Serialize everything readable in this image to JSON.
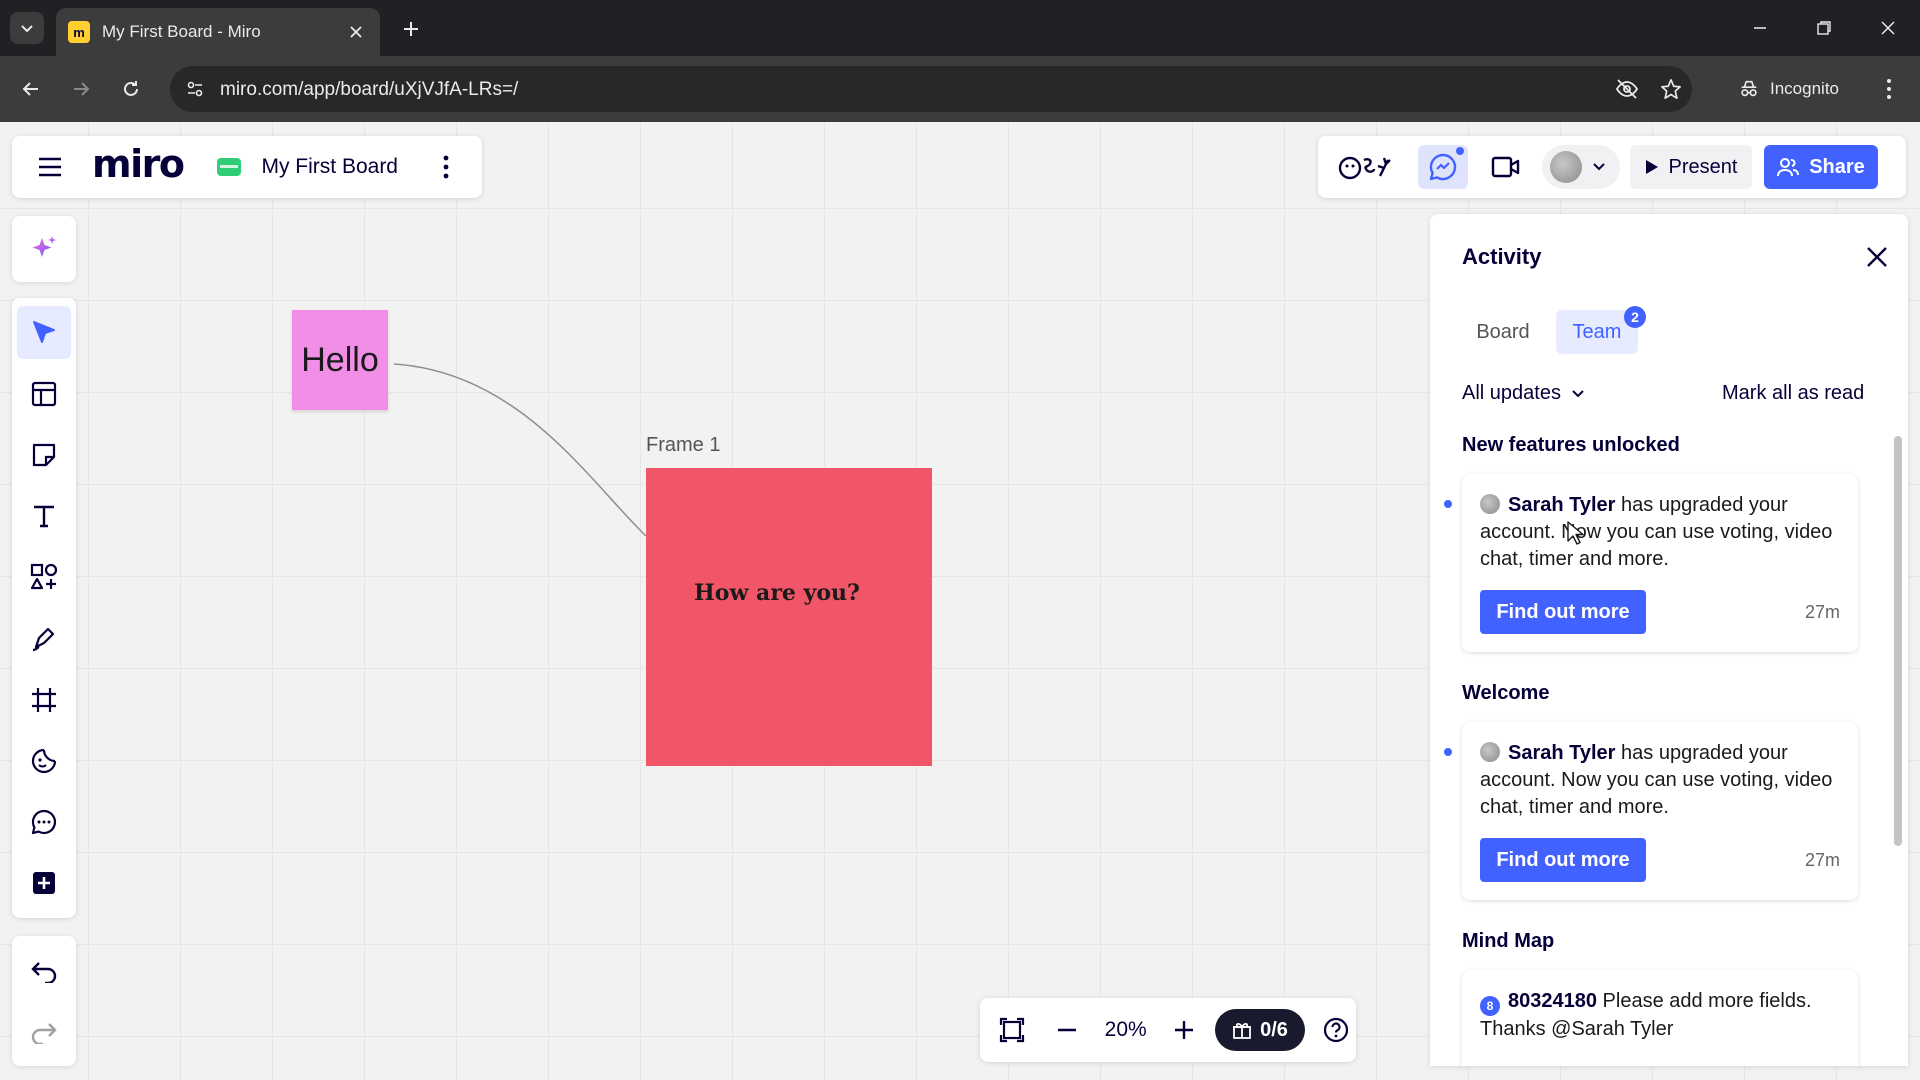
{
  "browser": {
    "tab_title": "My First Board - Miro",
    "tab_favicon": "m",
    "url": "miro.com/app/board/uXjVJfA-LRs=/",
    "incognito_label": "Incognito"
  },
  "board": {
    "logo": "miro",
    "name": "My First Board"
  },
  "collab": {
    "present_label": "Present",
    "share_label": "Share"
  },
  "toolbar_icons": [
    "ai-sparkle-icon",
    "select-cursor-icon",
    "templates-icon",
    "sticky-note-icon",
    "text-icon",
    "shapes-icon",
    "pen-icon",
    "frame-icon",
    "stickers-icon",
    "comment-icon",
    "more-apps-icon",
    "undo-icon",
    "redo-icon"
  ],
  "canvas": {
    "sticky_text": "Hello",
    "frame_label": "Frame 1",
    "frame_text": "How are you?"
  },
  "bottom_bar": {
    "zoom": "20%",
    "hidden_count": "0/6"
  },
  "activity": {
    "title": "Activity",
    "tabs": [
      {
        "label": "Board"
      },
      {
        "label": "Team",
        "badge": "2"
      }
    ],
    "filter_label": "All updates",
    "mark_all_label": "Mark all as read",
    "sections": [
      {
        "title": "New features unlocked",
        "author": "Sarah Tyler",
        "message": " has upgraded your account. Now you can use voting, video chat, timer and more.",
        "button": "Find out more",
        "time": "27m"
      },
      {
        "title": "Welcome",
        "author": "Sarah Tyler",
        "message": " has upgraded your account. Now you can use voting, video chat, timer and more.",
        "button": "Find out more",
        "time": "27m"
      },
      {
        "title": "Mind Map",
        "avatar_text": "8",
        "author": "80324180",
        "message": " Please add more fields. Thanks @Sarah Tyler"
      }
    ]
  },
  "colors": {
    "accent": "#4262ff",
    "sticky": "#f28ee6",
    "frame": "#f15668",
    "board_icon": "#2fcd76"
  }
}
